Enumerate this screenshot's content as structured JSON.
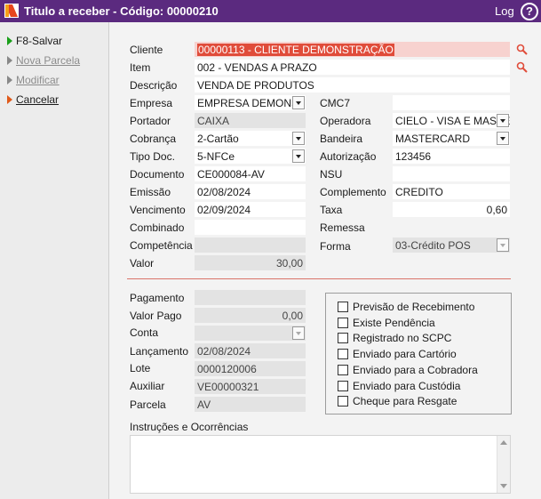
{
  "window": {
    "title": "Titulo a receber - Código: 00000210",
    "log_label": "Log",
    "help_label": "?"
  },
  "menu": {
    "save": "F8-Salvar",
    "new_parcel": "Nova Parcela",
    "modify": "Modificar",
    "cancel": "Cancelar"
  },
  "form": {
    "cliente": {
      "label": "Cliente",
      "value": "00000113 - CLIENTE DEMONSTRAÇÃO"
    },
    "item": {
      "label": "Item",
      "value": "002 - VENDAS A PRAZO"
    },
    "descricao": {
      "label": "Descrição",
      "value": "VENDA DE PRODUTOS"
    },
    "empresa": {
      "label": "Empresa",
      "value": "EMPRESA DEMONSTRAÇÃO"
    },
    "cmc7": {
      "label": "CMC7",
      "value": ""
    },
    "portador": {
      "label": "Portador",
      "value": "CAIXA"
    },
    "operadora": {
      "label": "Operadora",
      "value": "CIELO - VISA E MASTER"
    },
    "cobranca": {
      "label": "Cobrança",
      "value": "2-Cartão"
    },
    "bandeira": {
      "label": "Bandeira",
      "value": "MASTERCARD"
    },
    "tipo_doc": {
      "label": "Tipo Doc.",
      "value": "5-NFCe"
    },
    "autorizacao": {
      "label": "Autorização",
      "value": "123456"
    },
    "documento": {
      "label": "Documento",
      "value": "CE000084-AV"
    },
    "nsu": {
      "label": "NSU",
      "value": ""
    },
    "emissao": {
      "label": "Emissão",
      "value": "02/08/2024"
    },
    "complemento": {
      "label": "Complemento",
      "value": "CREDITO"
    },
    "vencimento": {
      "label": "Vencimento",
      "value": "02/09/2024"
    },
    "taxa": {
      "label": "Taxa",
      "value": "0,60"
    },
    "combinado": {
      "label": "Combinado",
      "value": ""
    },
    "remessa": {
      "label": "Remessa",
      "value": ""
    },
    "competencia": {
      "label": "Competência",
      "value": ""
    },
    "forma": {
      "label": "Forma",
      "value": "03-Crédito POS"
    },
    "valor": {
      "label": "Valor",
      "value": "30,00"
    },
    "pagamento": {
      "label": "Pagamento",
      "value": ""
    },
    "valor_pago": {
      "label": "Valor Pago",
      "value": "0,00"
    },
    "conta": {
      "label": "Conta",
      "value": ""
    },
    "lancamento": {
      "label": "Lançamento",
      "value": "02/08/2024"
    },
    "lote": {
      "label": "Lote",
      "value": "0000120006"
    },
    "auxiliar": {
      "label": "Auxiliar",
      "value": "VE00000321"
    },
    "parcela": {
      "label": "Parcela",
      "value": "AV"
    }
  },
  "checkboxes": [
    {
      "label": "Previsão de Recebimento",
      "checked": false
    },
    {
      "label": "Existe Pendência",
      "checked": false
    },
    {
      "label": "Registrado no SCPC",
      "checked": false
    },
    {
      "label": "Enviado para Cartório",
      "checked": false
    },
    {
      "label": "Enviado para a Cobradora",
      "checked": false
    },
    {
      "label": "Enviado para Custódia",
      "checked": false
    },
    {
      "label": "Cheque para Resgate",
      "checked": false
    }
  ],
  "instructions": {
    "label": "Instruções e Ocorrências",
    "value": ""
  },
  "colors": {
    "titlebar": "#5b2a7f",
    "accent": "#e04c3a",
    "separator": "#d9746a"
  }
}
